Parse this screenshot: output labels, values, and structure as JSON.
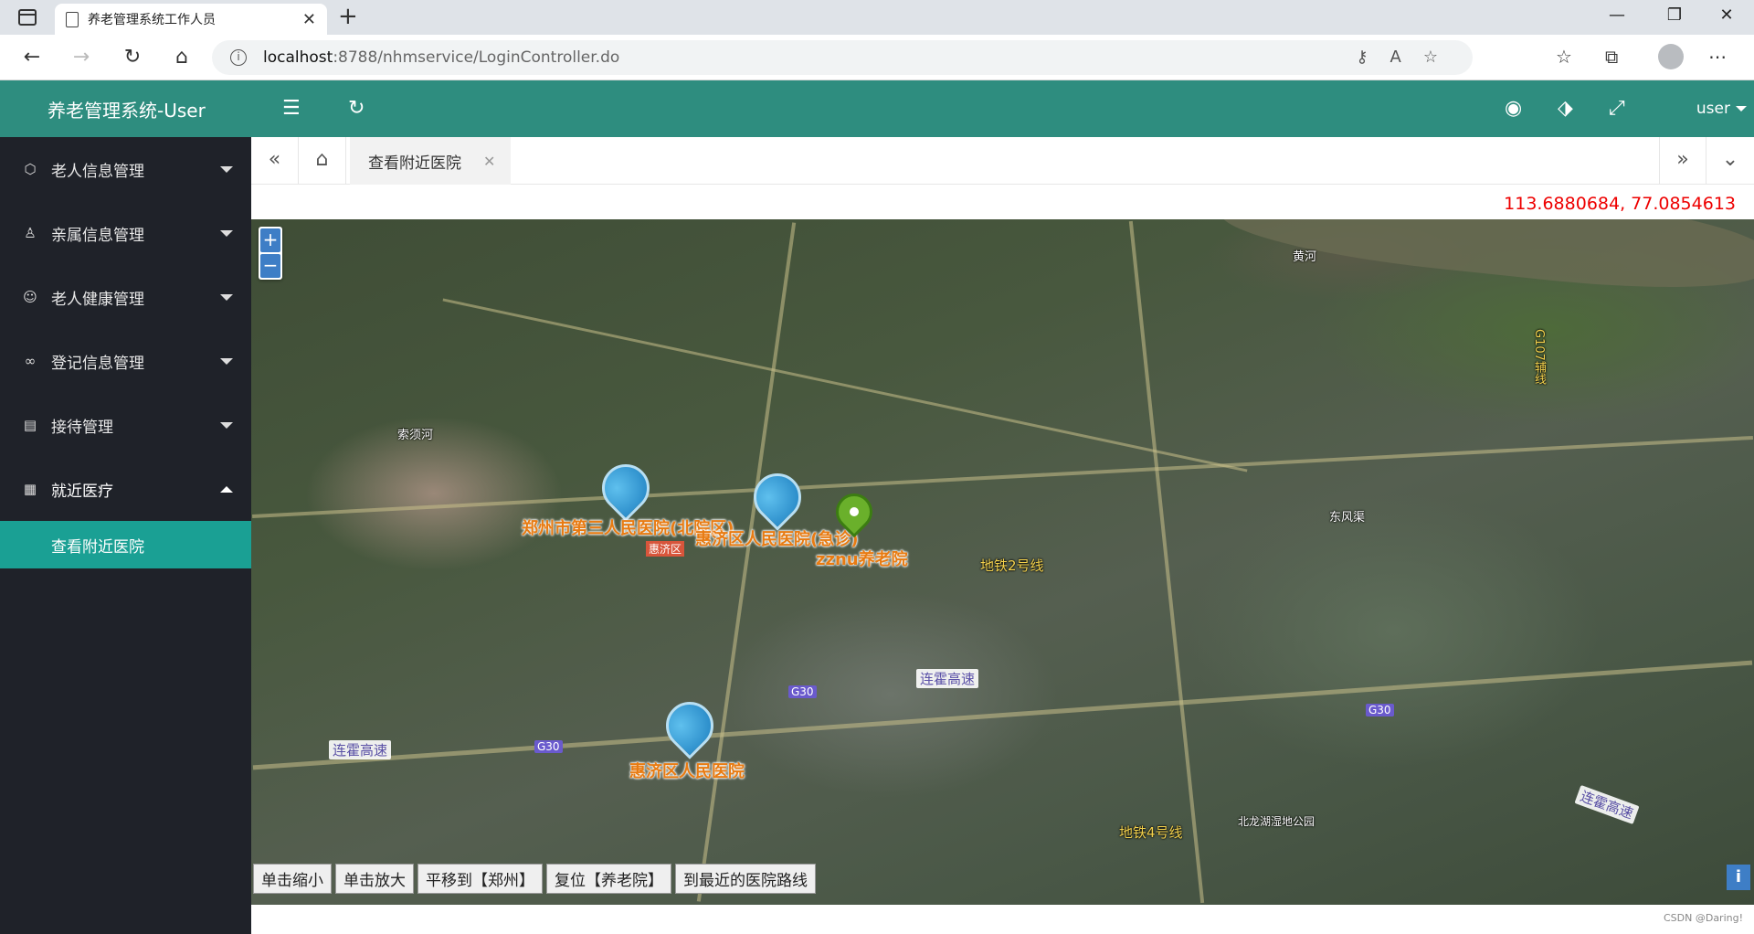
{
  "browser": {
    "tab_title": "养老管理系统工作人员",
    "url_host": "localhost",
    "url_path": ":8788/nhmservice/LoginController.do"
  },
  "app": {
    "brand": "养老管理系统-User",
    "user": "user"
  },
  "sidebar": {
    "items": [
      {
        "label": "老人信息管理",
        "icon": "cube-icon"
      },
      {
        "label": "亲属信息管理",
        "icon": "user-icon"
      },
      {
        "label": "老人健康管理",
        "icon": "smile-icon"
      },
      {
        "label": "登记信息管理",
        "icon": "link-icon"
      },
      {
        "label": "接待管理",
        "icon": "doc-icon"
      },
      {
        "label": "就近医疗",
        "icon": "grid-icon"
      }
    ],
    "sub_item": "查看附近医院"
  },
  "tabs": {
    "active": "查看附近医院"
  },
  "coords": "113.6880684, 77.0854613",
  "map": {
    "markers": [
      {
        "label": "郑州市第三人民医院(北院区)"
      },
      {
        "label": "惠济区人民医院(急诊)"
      },
      {
        "label": "zznu养老院"
      },
      {
        "label": "惠济区人民医院"
      }
    ],
    "buttons": [
      "单击缩小",
      "单击放大",
      "平移到【郑州】",
      "复位【养老院】",
      "到最近的医院路线"
    ],
    "place_labels": [
      "黄河",
      "索须河",
      "东风渠",
      "连霍高速",
      "地铁2号线",
      "地铁4号线",
      "惠济区",
      "G30",
      "G107辅线",
      "北龙湖湿地公园"
    ]
  },
  "watermark": "CSDN @Daring!"
}
